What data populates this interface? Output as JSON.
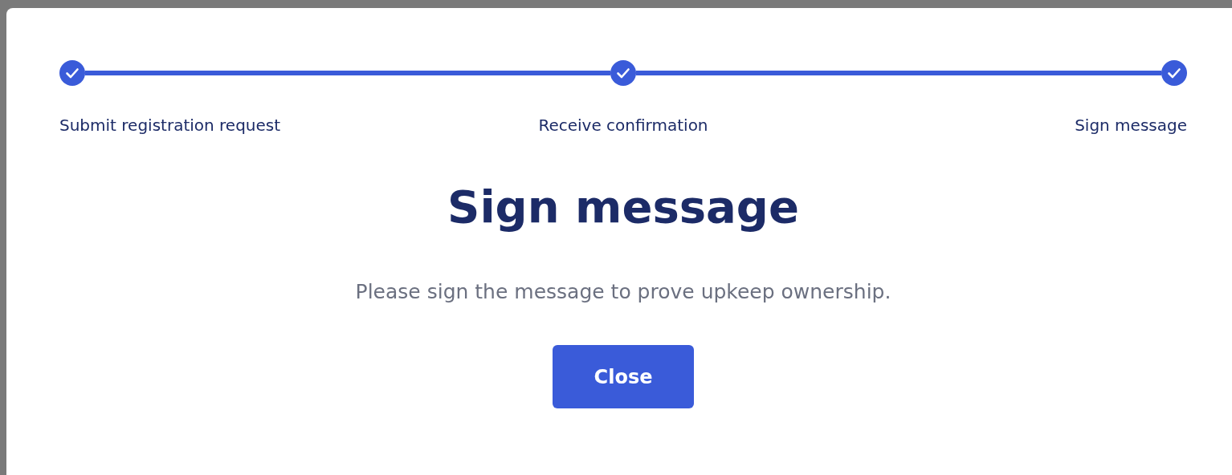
{
  "steps": [
    {
      "label": "Submit registration request",
      "completed": true
    },
    {
      "label": "Receive confirmation",
      "completed": true
    },
    {
      "label": "Sign message",
      "completed": true
    }
  ],
  "title": "Sign message",
  "message": "Please sign the message to prove upkeep ownership.",
  "close_button": "Close"
}
